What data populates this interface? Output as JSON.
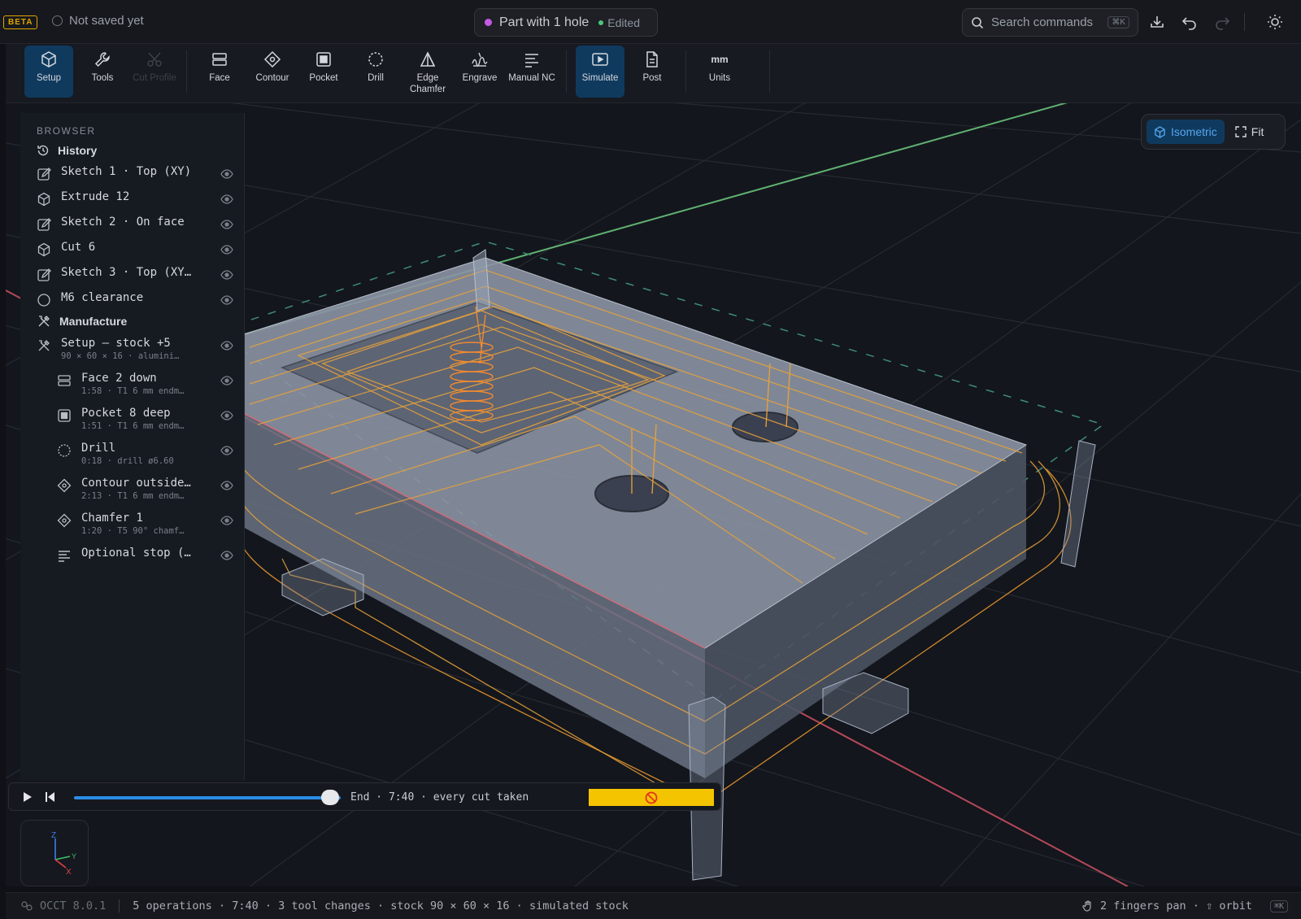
{
  "topbar": {
    "beta": "BETA",
    "save_state": "Not saved yet",
    "doc_title": "Part with 1 hole",
    "doc_status": "Edited",
    "search_placeholder": "Search commands",
    "search_kbd": "⌘K"
  },
  "toolbar": {
    "setup": "Setup",
    "tools": "Tools",
    "cut_profile": "Cut Profile",
    "face": "Face",
    "contour": "Contour",
    "pocket": "Pocket",
    "drill": "Drill",
    "edge_chamfer": "Edge Chamfer",
    "engrave": "Engrave",
    "manual_nc": "Manual NC",
    "simulate": "Simulate",
    "post": "Post",
    "units_glyph": "mm",
    "units": "Units"
  },
  "view": {
    "isometric": "Isometric",
    "fit": "Fit"
  },
  "browser": {
    "title": "BROWSER",
    "history_label": "History",
    "history": [
      {
        "name": "Sketch 1 · Top (XY)",
        "icon": "sketch-icon"
      },
      {
        "name": "Extrude 12",
        "icon": "cube-icon"
      },
      {
        "name": "Sketch 2 · On face",
        "icon": "sketch-icon"
      },
      {
        "name": "Cut 6",
        "icon": "cube-icon"
      },
      {
        "name": "Sketch 3 · Top (XY…",
        "icon": "sketch-icon"
      },
      {
        "name": "M6 clearance",
        "icon": "circle-icon"
      }
    ],
    "manufacture_label": "Manufacture",
    "setup": {
      "name": "Setup — stock +5",
      "sub": "90 × 60 × 16 · alumini…"
    },
    "operations": [
      {
        "name": "Face 2 down",
        "sub": "1:58 · T1 6 mm endm…",
        "icon": "face-icon"
      },
      {
        "name": "Pocket 8 deep",
        "sub": "1:51 · T1 6 mm endm…",
        "icon": "pocket-icon"
      },
      {
        "name": "Drill",
        "sub": "0:18 · drill ø6.60",
        "icon": "drill-icon"
      },
      {
        "name": "Contour outside…",
        "sub": "2:13 · T1 6 mm endm…",
        "icon": "contour-icon"
      },
      {
        "name": "Chamfer 1",
        "sub": "1:20 · T5 90° chamf…",
        "icon": "chamfer-icon"
      },
      {
        "name": "Optional stop (…",
        "sub": "",
        "icon": "nc-icon"
      }
    ]
  },
  "playback": {
    "progress": 1.0,
    "status": "End · 7:40 · every cut taken"
  },
  "statusbar": {
    "engine": "OCCT 8.0.1",
    "summary": "5 operations · 7:40 · 3 tool changes · stock 90 × 60 × 16 · simulated stock",
    "hint": "2 fingers pan · ⇧ orbit",
    "kbd": "⌘K"
  },
  "axis": {
    "z": "Z",
    "y": "Y",
    "x": "X"
  },
  "colors": {
    "accent": "#2b8de6",
    "active_bg": "#0f3a5e",
    "warning": "#f5c400",
    "toolpath": "#e8a23a"
  }
}
